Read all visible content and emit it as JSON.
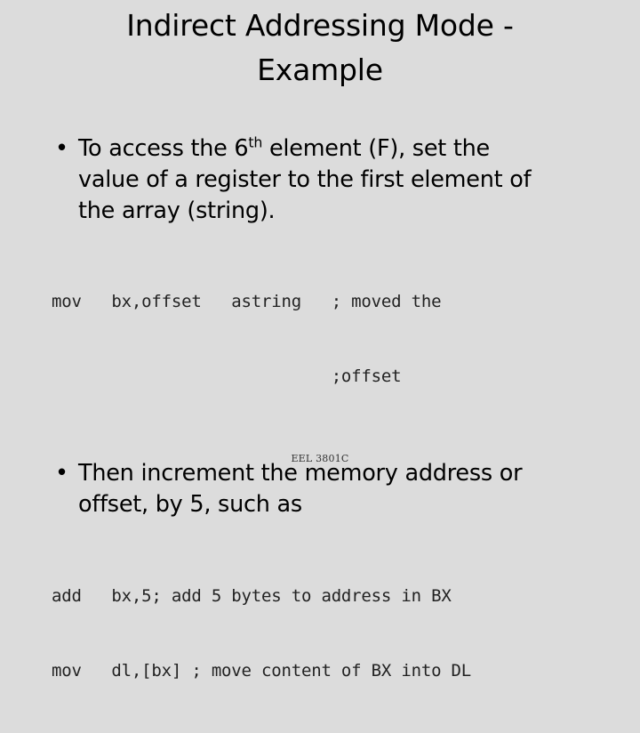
{
  "slide": {
    "background_color": "#dcdcdc",
    "text_color": "#000000",
    "code_color": "#222222"
  },
  "title": {
    "line1": "Indirect Addressing Mode -",
    "line2": "Example"
  },
  "bullets": [
    {
      "marker": "•",
      "line1_pre": "To access the 6",
      "line1_sup": "th",
      "line1_post": " element (F), set the",
      "line2": "value of a register to the first element of",
      "line3": "the array (string)."
    },
    {
      "marker": "•",
      "line1": "Then increment the memory address or",
      "line2": "offset, by 5, such as"
    }
  ],
  "code_blocks": [
    {
      "line1": "mov   bx,offset   astring   ; moved the",
      "line2": "                            ;offset"
    },
    {
      "line1": "add   bx,5; add 5 bytes to address in BX",
      "line2": "mov   dl,[bx] ; move content of BX into DL"
    }
  ],
  "footer": {
    "text": "EEL 3801C"
  }
}
